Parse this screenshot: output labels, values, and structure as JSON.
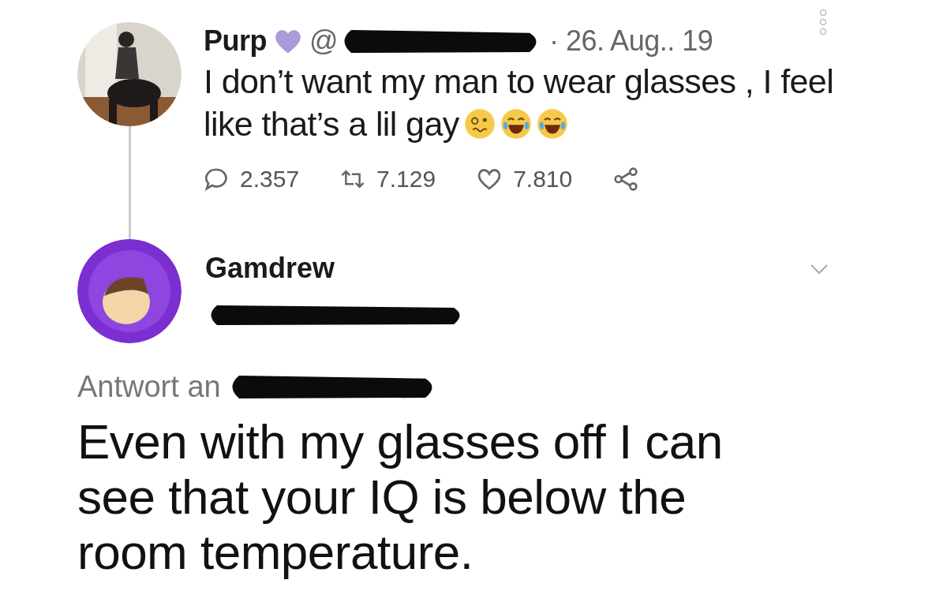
{
  "tweet": {
    "author": "Purp",
    "handle": "@",
    "date": "· 26. Aug.. 19",
    "lines": [
      "I don’t want my man to wear glasses , I feel",
      "like that’s a lil gay"
    ],
    "emojis": [
      {
        "kind": "woozy"
      },
      {
        "kind": "laughing"
      },
      {
        "kind": "laughing"
      }
    ],
    "stats": [
      {
        "kind": "reply",
        "count": "2.357"
      },
      {
        "kind": "retweet",
        "count": "7.129"
      },
      {
        "kind": "like",
        "count": "7.810"
      },
      {
        "kind": "share"
      }
    ]
  },
  "reply": {
    "author": "Gamdrew",
    "reply_to": "Antwort an",
    "text": "Even with my glasses off I can see that your IQ is below the room temperature."
  }
}
